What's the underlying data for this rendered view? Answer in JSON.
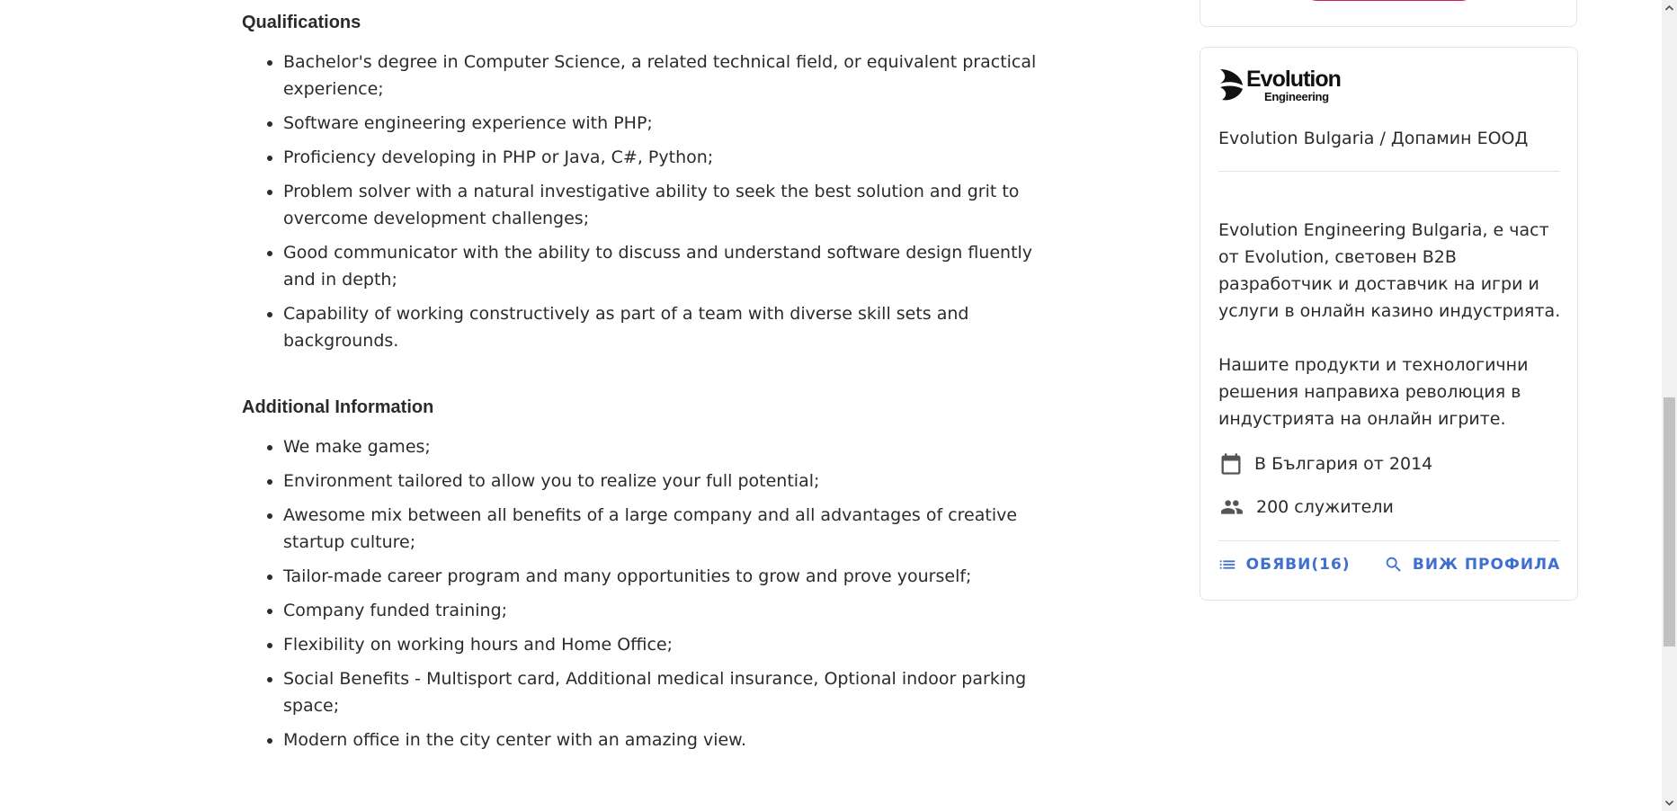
{
  "qualifications": {
    "title": "Qualifications",
    "items": [
      "Bachelor's degree in Computer Science, a related technical field, or equivalent practical experience;",
      "Software engineering experience with PHP;",
      "Proficiency developing in PHP or Java, C#, Python;",
      "Problem solver with a natural investigative ability to seek the best solution and grit to overcome development challenges;",
      "Good communicator with the ability to discuss and understand software design fluently and in depth;",
      "Capability of working constructively as part of a team with diverse skill sets and backgrounds."
    ]
  },
  "additional": {
    "title": "Additional Information",
    "items": [
      "We make games;",
      "Environment tailored to allow you to realize your full potential;",
      "Awesome mix between all benefits of a large company and all advantages of creative startup culture;",
      "Tailor-made career program and many opportunities to grow and prove yourself;",
      "Company funded training;",
      "Flexibility on working hours and Home Office;",
      "Social Benefits - Multisport card, Additional medical insurance, Optional indoor parking space;",
      "Modern office in the city center with an amazing view."
    ]
  },
  "company": {
    "logo_word": "Evolution",
    "logo_sub": "Engineering",
    "name": "Evolution Bulgaria / Допамин ЕООД",
    "description_1": "Evolution Engineering Bulgaria, е част от Evolution, световен B2B разработчик и доставчик на игри и услуги в онлайн казино индустрията.",
    "description_2": "Нашите продукти и технологични решения направиха революция в индустрията на онлайн игрите.",
    "since": "В България от 2014",
    "employees": "200 служители",
    "jobs_button": "ОБЯВИ(16)",
    "profile_button": "ВИЖ ПРОФИЛА",
    "icons": [
      "calendar-icon",
      "people-icon",
      "list-icon",
      "search-icon",
      "evolution-logo-icon"
    ],
    "accent_color": "#3f6fd1"
  }
}
